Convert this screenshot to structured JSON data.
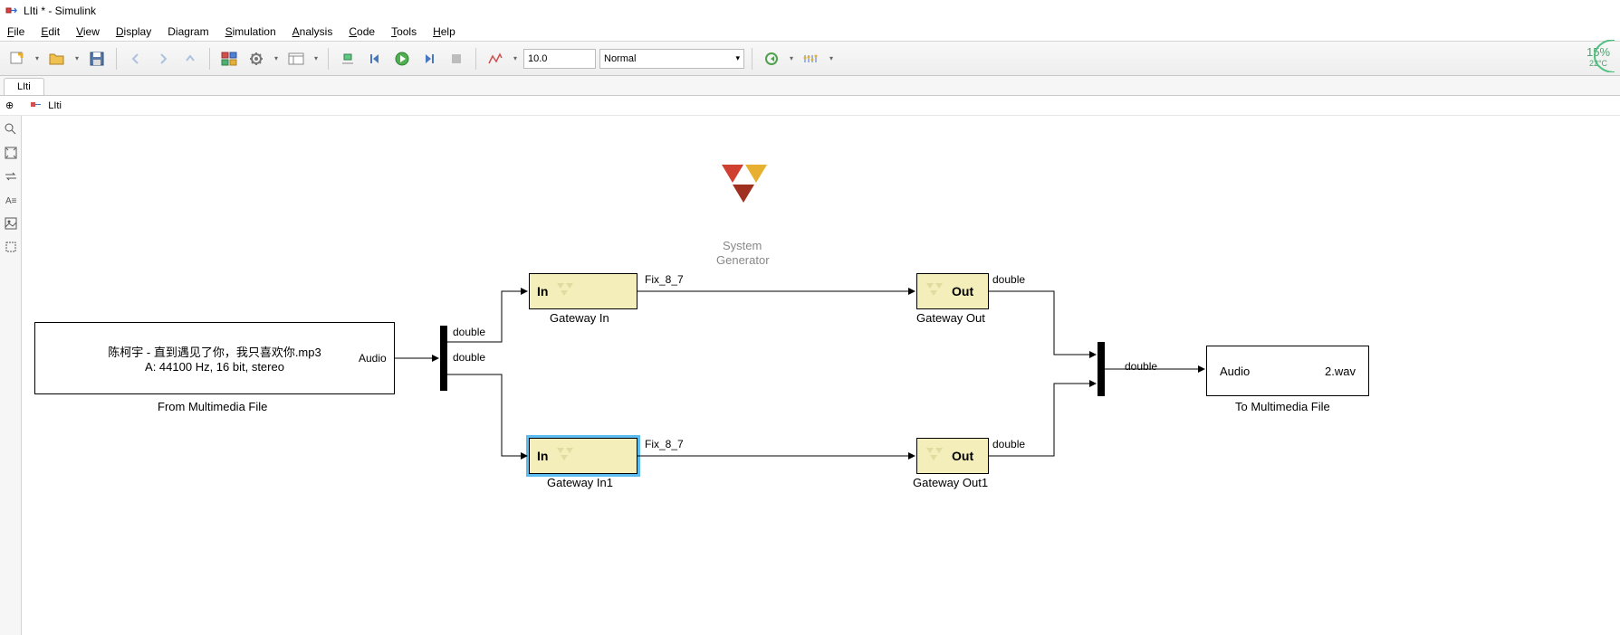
{
  "titlebar": {
    "title": "LIti * - Simulink"
  },
  "menubar": {
    "file": "File",
    "edit": "Edit",
    "view": "View",
    "display": "Display",
    "diagram": "Diagram",
    "simulation": "Simulation",
    "analysis": "Analysis",
    "code": "Code",
    "tools": "Tools",
    "help": "Help"
  },
  "toolbar": {
    "stop_time": "10.0",
    "sim_mode": "Normal"
  },
  "tab": {
    "name": "LIti"
  },
  "breadcrumb": {
    "model": "LIti"
  },
  "weather": {
    "pct": "15%",
    "temp": "22°C"
  },
  "blocks": {
    "from_mm_file": {
      "line1": "陈柯宇 - 直到遇见了你，我只喜欢你.mp3",
      "line2": "A: 44100 Hz, 16 bit, stereo",
      "port_out": "Audio",
      "caption": "From Multimedia File"
    },
    "demux_out": {
      "sig1": "double",
      "sig2": "double"
    },
    "gw_in1": {
      "txt": "In",
      "caption": "Gateway In",
      "out_sig": "Fix_8_7"
    },
    "gw_in2": {
      "txt": "In",
      "caption": "Gateway In1",
      "out_sig": "Fix_8_7"
    },
    "sysgen": {
      "line1": "System",
      "line2": "Generator"
    },
    "gw_out1": {
      "txt": "Out",
      "caption": "Gateway Out",
      "out_sig": "double"
    },
    "gw_out2": {
      "txt": "Out",
      "caption": "Gateway Out1",
      "out_sig": "double"
    },
    "mux_out": {
      "sig": "double"
    },
    "to_mm_file": {
      "port_in": "Audio",
      "filename": "2.wav",
      "caption": "To Multimedia File"
    }
  }
}
